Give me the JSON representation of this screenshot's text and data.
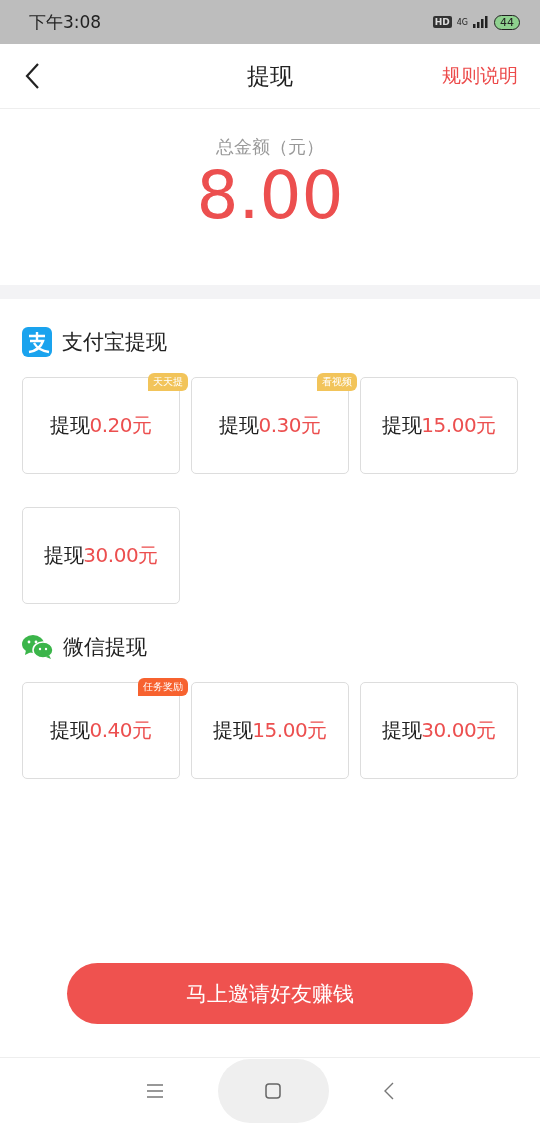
{
  "status_bar": {
    "time": "下午3:08",
    "hd": "HD",
    "network": "4G",
    "battery": "44"
  },
  "header": {
    "title": "提现",
    "action": "规则说明"
  },
  "total": {
    "label": "总金额（元）",
    "amount": "8.00"
  },
  "sections": [
    {
      "kind": "alipay",
      "title": "支付宝提现",
      "options": [
        {
          "label": "提现",
          "amount": "0.20元",
          "badge": {
            "text": "天天提",
            "color": "#f2c45a"
          }
        },
        {
          "label": "提现",
          "amount": "0.30元",
          "badge": {
            "text": "看视频",
            "color": "#f2c45a"
          }
        },
        {
          "label": "提现",
          "amount": "15.00元"
        },
        {
          "label": "提现",
          "amount": "30.00元"
        }
      ]
    },
    {
      "kind": "wechat",
      "title": "微信提现",
      "options": [
        {
          "label": "提现",
          "amount": "0.40元",
          "badge": {
            "text": "任务奖励",
            "color": "#f7622f"
          }
        },
        {
          "label": "提现",
          "amount": "15.00元"
        },
        {
          "label": "提现",
          "amount": "30.00元"
        }
      ]
    }
  ],
  "invite_button": "马上邀请好友赚钱"
}
